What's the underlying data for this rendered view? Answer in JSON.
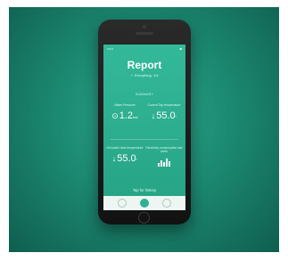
{
  "screen": {
    "status": {
      "carrier": "•••••",
      "time": "",
      "battery": "■"
    },
    "title": "Report",
    "subtitle": "✓ Everything: 1/4",
    "section_label": "SUMMARY",
    "metrics": [
      {
        "label": "Water Pressure",
        "symbol": "⊙",
        "value": "1.2",
        "unit": "bar"
      },
      {
        "label": "Current Tap temperature",
        "symbol": "↓",
        "value": "55.0",
        "unit": "°"
      },
      {
        "label": "Hot water tank temperature",
        "symbol": "↓",
        "value": "55.0",
        "unit": "°"
      },
      {
        "label": "Electricity consumption last week",
        "icon": "bar-chart-icon"
      }
    ],
    "footer": "Tap for history",
    "tabs": [
      "home",
      "report",
      "settings"
    ]
  },
  "colors": {
    "accent": "#2fb293",
    "background": "#1c8a72",
    "screen_top": "#33b99a"
  }
}
